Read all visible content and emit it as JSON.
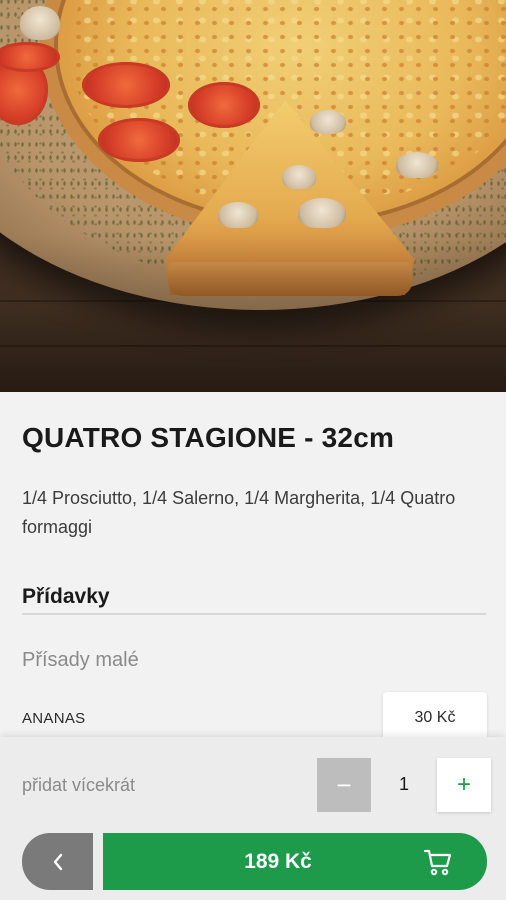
{
  "product": {
    "title": "QUATRO STAGIONE - 32cm",
    "description": "1/4 Prosciutto, 1/4 Salerno, 1/4 Margherita, 1/4 Quatro formaggi"
  },
  "extras": {
    "heading": "Přídavky",
    "group_label": "Přísady malé",
    "items": [
      {
        "name": "ANANAS",
        "price": "30 Kč"
      }
    ]
  },
  "quantity": {
    "label": "přidat vícekrát",
    "value": "1",
    "minus": "−",
    "plus": "+"
  },
  "cart": {
    "total": "189 Kč"
  },
  "icons": {
    "back": "chevron-left-icon",
    "cart": "shopping-cart-icon"
  },
  "colors": {
    "accent": "#1e9b4a",
    "back_button": "#7a7a7a",
    "minus_disabled": "#bdbdbd"
  }
}
